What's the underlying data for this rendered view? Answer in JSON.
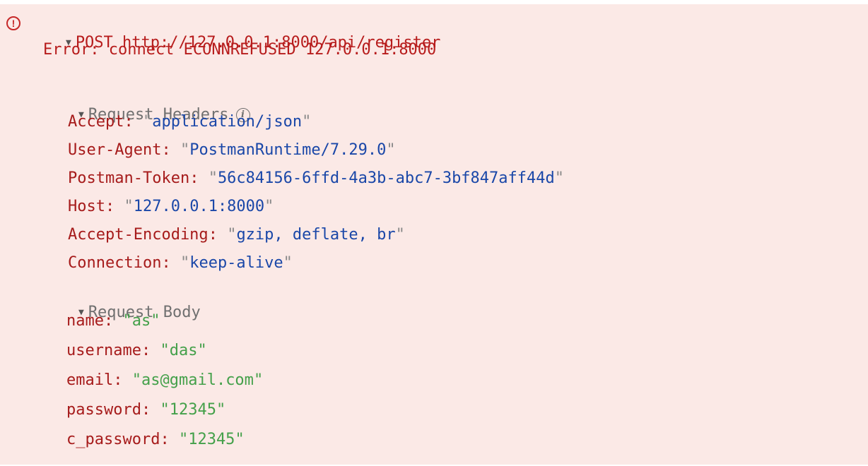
{
  "request": {
    "method": "POST",
    "url": "http://127.0.0.1:8000/api/register",
    "error": "Error: connect ECONNREFUSED 127.0.0.1:8000",
    "error_icon": "error-circle-icon",
    "caret_icon": "caret-down-icon"
  },
  "headers_section": {
    "title": "Request Headers",
    "info_icon": "info-icon",
    "items": [
      {
        "key": "Accept",
        "value": "application/json"
      },
      {
        "key": "User-Agent",
        "value": "PostmanRuntime/7.29.0"
      },
      {
        "key": "Postman-Token",
        "value": "56c84156-6ffd-4a3b-abc7-3bf847aff44d"
      },
      {
        "key": "Host",
        "value": "127.0.0.1:8000"
      },
      {
        "key": "Accept-Encoding",
        "value": "gzip, deflate, br"
      },
      {
        "key": "Connection",
        "value": "keep-alive"
      }
    ]
  },
  "body_section": {
    "title": "Request Body",
    "items": [
      {
        "key": "name",
        "value": "as"
      },
      {
        "key": "username",
        "value": "das"
      },
      {
        "key": "email",
        "value": "as@gmail.com"
      },
      {
        "key": "password",
        "value": "12345"
      },
      {
        "key": "c_password",
        "value": "12345"
      }
    ]
  },
  "colors": {
    "background": "#fbe9e6",
    "error": "#b71c1c",
    "header_value": "#1a47a8",
    "body_value": "#44a04a"
  }
}
